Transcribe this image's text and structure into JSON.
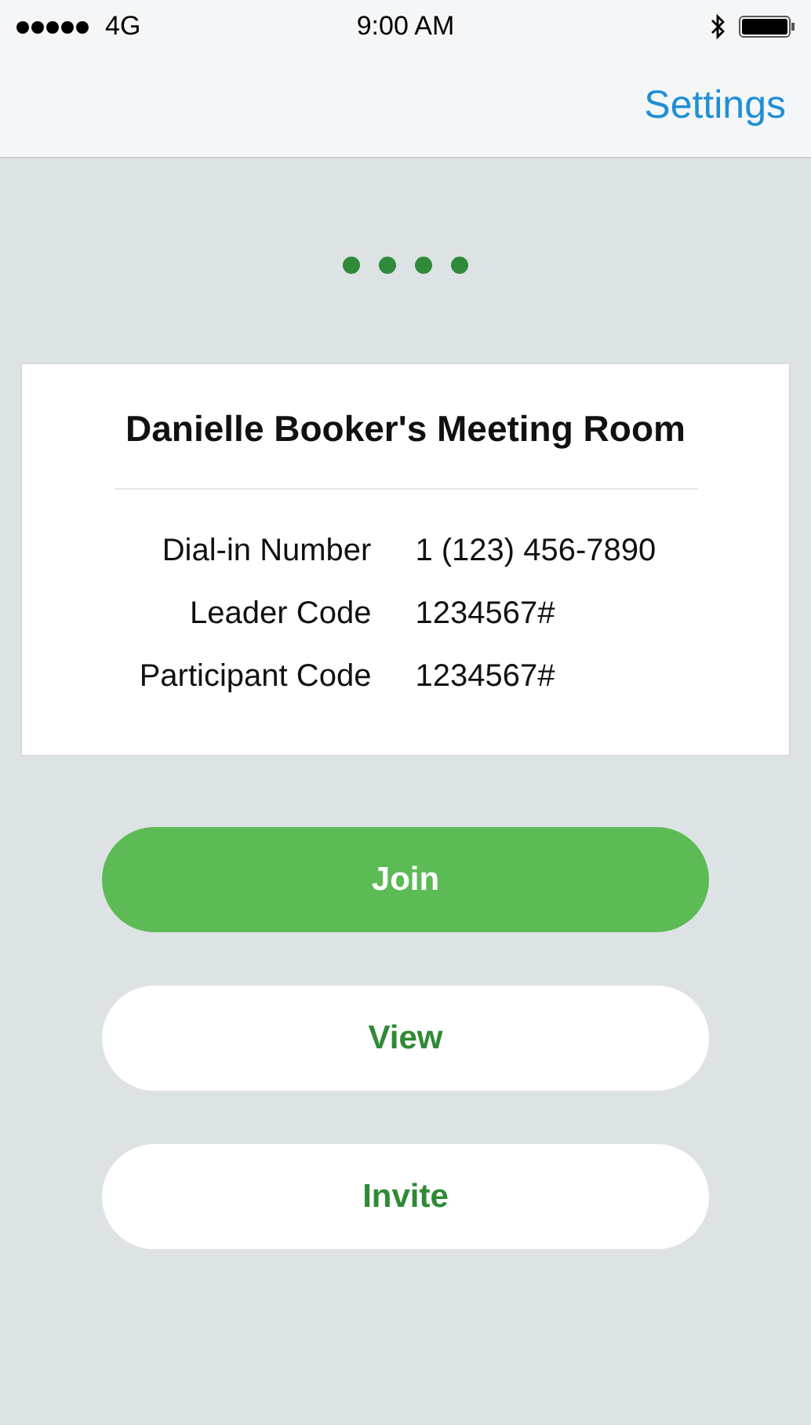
{
  "status_bar": {
    "carrier": "4G",
    "time": "9:00 AM"
  },
  "nav_bar": {
    "action": "Settings"
  },
  "meeting": {
    "title": "Danielle Booker's Meeting Room",
    "details": [
      {
        "label": "Dial-in Number",
        "value": "1 (123) 456-7890"
      },
      {
        "label": "Leader Code",
        "value": "1234567#"
      },
      {
        "label": "Participant Code",
        "value": "1234567#"
      }
    ]
  },
  "buttons": [
    {
      "label": "Join",
      "kind": "primary"
    },
    {
      "label": "View",
      "kind": "secondary"
    },
    {
      "label": "Invite",
      "kind": "secondary"
    }
  ]
}
